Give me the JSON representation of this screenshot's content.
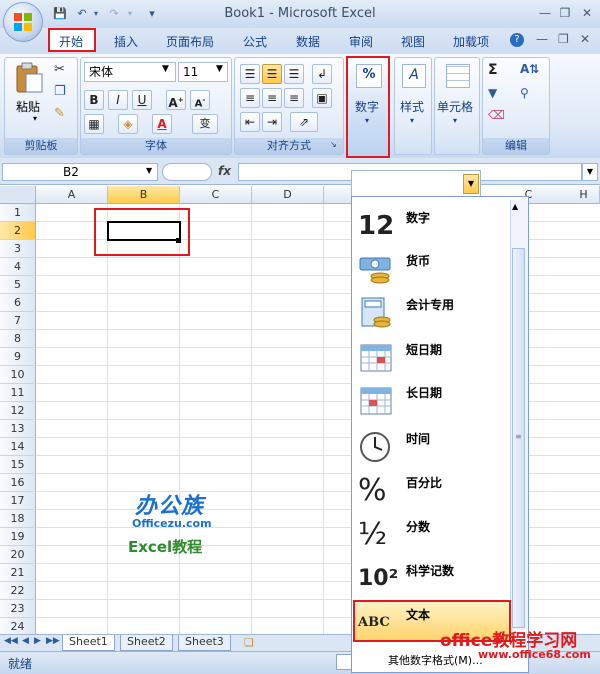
{
  "window": {
    "title": "Book1 - Microsoft Excel"
  },
  "ribbon_tabs": [
    "开始",
    "插入",
    "页面布局",
    "公式",
    "数据",
    "审阅",
    "视图",
    "加载项"
  ],
  "groups": {
    "clipboard": {
      "label": "剪贴板",
      "paste": "粘贴"
    },
    "font": {
      "label": "字体",
      "name": "宋体",
      "size": "11",
      "phonetic": "变"
    },
    "alignment": {
      "label": "对齐方式"
    },
    "number": {
      "label": "数字",
      "button": "数字",
      "icon_text": "%"
    },
    "styles": {
      "label": "样式"
    },
    "cells": {
      "label": "单元格"
    },
    "editing": {
      "label": "编辑"
    }
  },
  "formula_bar": {
    "namebox": "B2",
    "fx": "fx"
  },
  "columns": [
    "A",
    "B",
    "C",
    "D",
    "C",
    "H"
  ],
  "rows": [
    "1",
    "2",
    "3",
    "4",
    "5",
    "6",
    "7",
    "8",
    "9",
    "10",
    "11",
    "12",
    "13",
    "14",
    "15",
    "16",
    "17",
    "18",
    "19",
    "20",
    "21",
    "22",
    "23",
    "24"
  ],
  "sheets": [
    "Sheet1",
    "Sheet2",
    "Sheet3"
  ],
  "status": {
    "ready": "就绪"
  },
  "number_formats": [
    {
      "label": "数字",
      "icon": "12"
    },
    {
      "label": "货币",
      "icon": "currency-icon"
    },
    {
      "label": "会计专用",
      "icon": "accounting-icon"
    },
    {
      "label": "短日期",
      "icon": "calendar-icon"
    },
    {
      "label": "长日期",
      "icon": "calendar-icon"
    },
    {
      "label": "时间",
      "icon": "clock-icon"
    },
    {
      "label": "百分比",
      "icon": "%"
    },
    {
      "label": "分数",
      "icon": "½"
    },
    {
      "label": "科学记数",
      "icon": "10²"
    },
    {
      "label": "文本",
      "icon": "ABC"
    }
  ],
  "more_formats": "其他数字格式(M)...",
  "logo": {
    "line1": "办公族",
    "line2": "Officezu.com",
    "line3": "Excel教程"
  },
  "watermark": {
    "line1": "office教程学习网",
    "line2": "www.office68.com"
  },
  "colors": {
    "highlight": "#e0181f",
    "ribbon": "#dfe9f7",
    "text": "#15428b"
  }
}
